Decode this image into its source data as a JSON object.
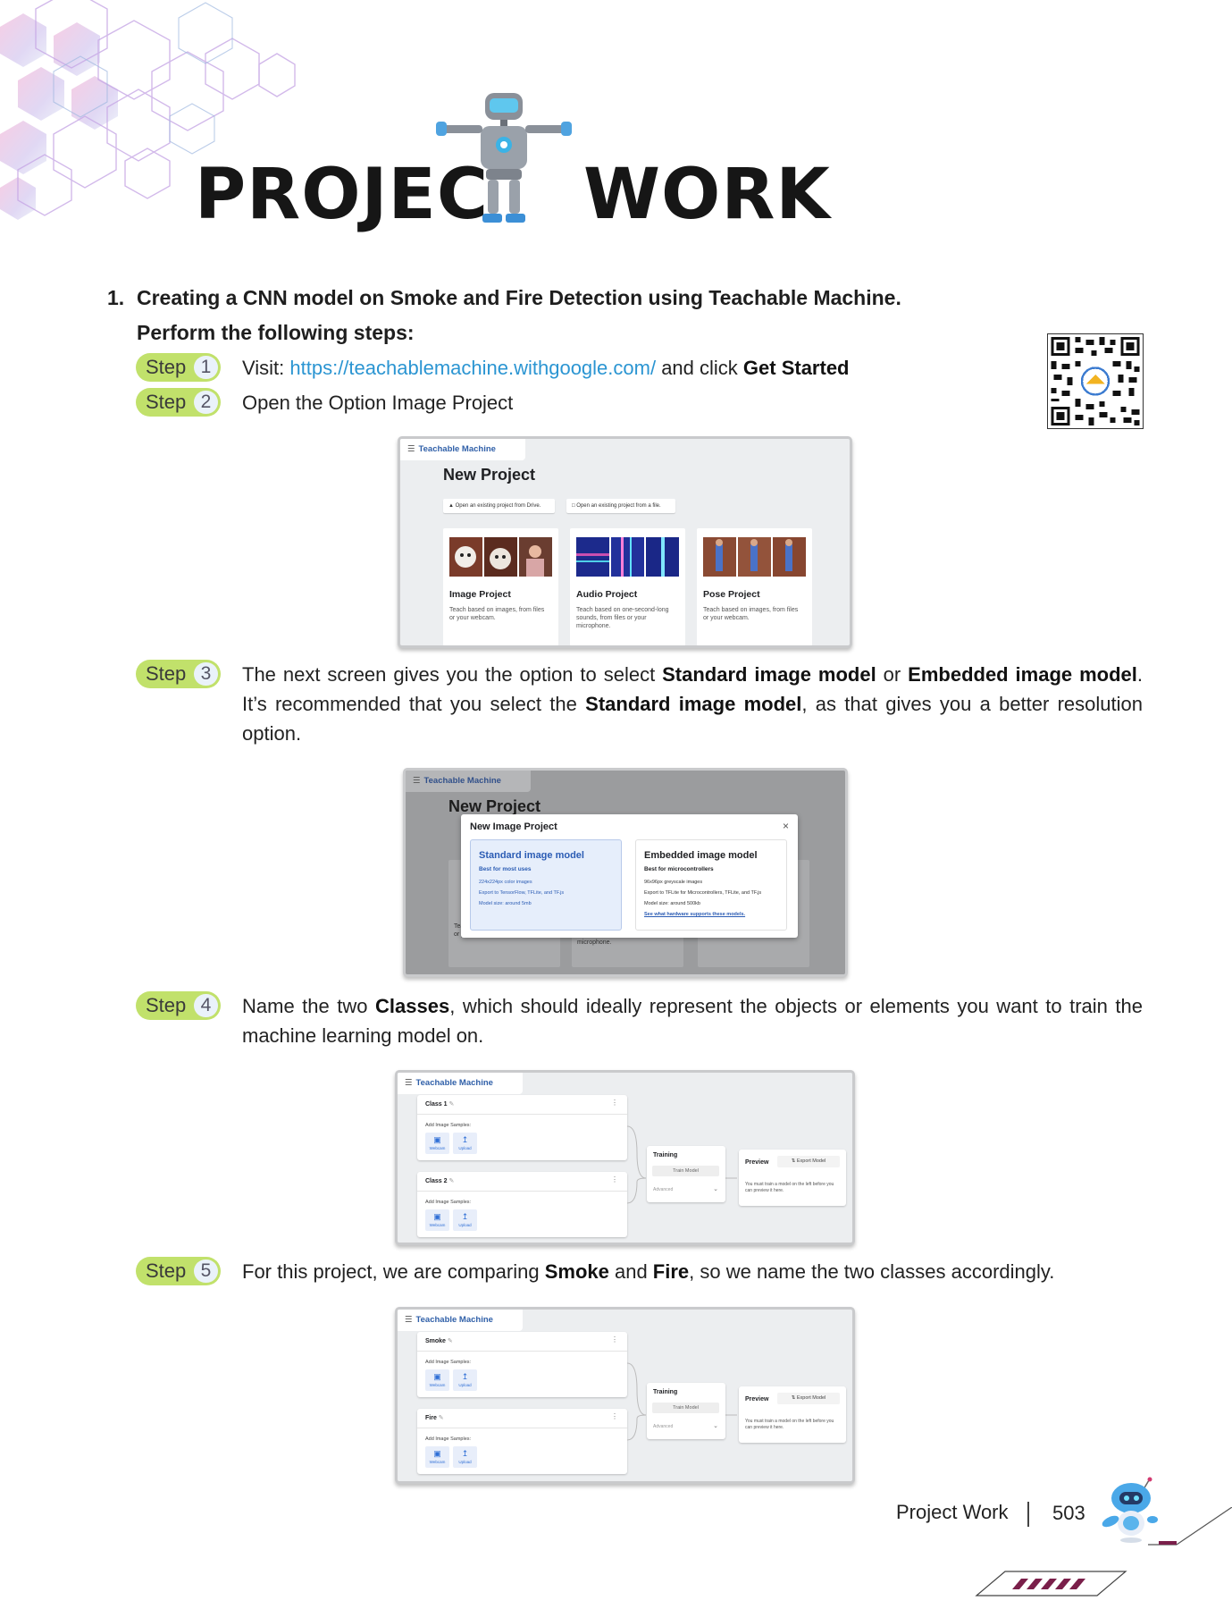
{
  "header": {
    "title_word_1": "PROJEC",
    "title_word_2": "WORK"
  },
  "question": {
    "number": "1.",
    "title": "Creating a CNN model on Smoke and Fire Detection using Teachable Machine.",
    "subtitle": "Perform the following steps:"
  },
  "step_label": "Step",
  "steps": [
    {
      "number": "1",
      "prefix": "Visit: ",
      "link": "https://teachablemachine.withgoogle.com/",
      "middle": " and click ",
      "bold": "Get Started"
    },
    {
      "number": "2",
      "text": "Open the Option Image Project"
    },
    {
      "number": "3",
      "t1": "The next screen gives you the option to select ",
      "b1": "Standard image model",
      "t2": " or ",
      "b2": "Embedded image model",
      "t3": ". It’s recommended that you select the ",
      "b3": "Standard image model",
      "t4": ", as that gives you a better resolution option."
    },
    {
      "number": "4",
      "t1": "Name the two ",
      "b1": "Classes",
      "t2": ", which should ideally represent the objects or elements you want to train the machine learning model on."
    },
    {
      "number": "5",
      "t1": "For this project, we are comparing ",
      "b1": "Smoke",
      "t2": " and ",
      "b2": "Fire",
      "t3": ", so we name the two classes accordingly."
    }
  ],
  "app": {
    "brand": "Teachable Machine",
    "new_project": "New Project",
    "open_drive": "Open an existing project from Drive.",
    "open_file": "Open an existing project from a file.",
    "cards": [
      {
        "name": "Image Project",
        "desc": "Teach based on images, from files or your webcam."
      },
      {
        "name": "Audio Project",
        "desc": "Teach based on one-second-long sounds, from files or your microphone."
      },
      {
        "name": "Pose Project",
        "desc": "Teach based on images, from files or your webcam."
      }
    ],
    "dialog": {
      "title": "New Image Project",
      "close": "×",
      "standard": {
        "title": "Standard image model",
        "subtitle": "Best for most uses",
        "lines": [
          "224x224px color images",
          "Export to TensorFlow, TFLite, and TF.js",
          "Model size: around 5mb"
        ]
      },
      "embedded": {
        "title": "Embedded image model",
        "subtitle": "Best for microcontrollers",
        "lines": [
          "96x96px greyscale images",
          "Export to TFLite for Microcontrollers, TFLite, and TF.js",
          "Model size: around 500kb"
        ],
        "link": "See what hardware supports these models."
      }
    },
    "class_panel": {
      "add_samples": "Add Image Samples:",
      "webcam": "Webcam",
      "upload": "Upload",
      "training": "Training",
      "train_model": "Train Model",
      "advanced": "Advanced",
      "preview": "Preview",
      "export_model": "Export Model",
      "preview_desc": "You must train a model on the left before you can preview it here."
    },
    "classes_default": [
      "Class 1",
      "Class 2"
    ],
    "classes_named": [
      "Smoke",
      "Fire"
    ]
  },
  "footer": {
    "label": "Project Work",
    "page": "503"
  },
  "colors": {
    "step_green": "#c1e16b",
    "link_blue": "#2b95d2",
    "brand_blue": "#2f5fa8"
  }
}
